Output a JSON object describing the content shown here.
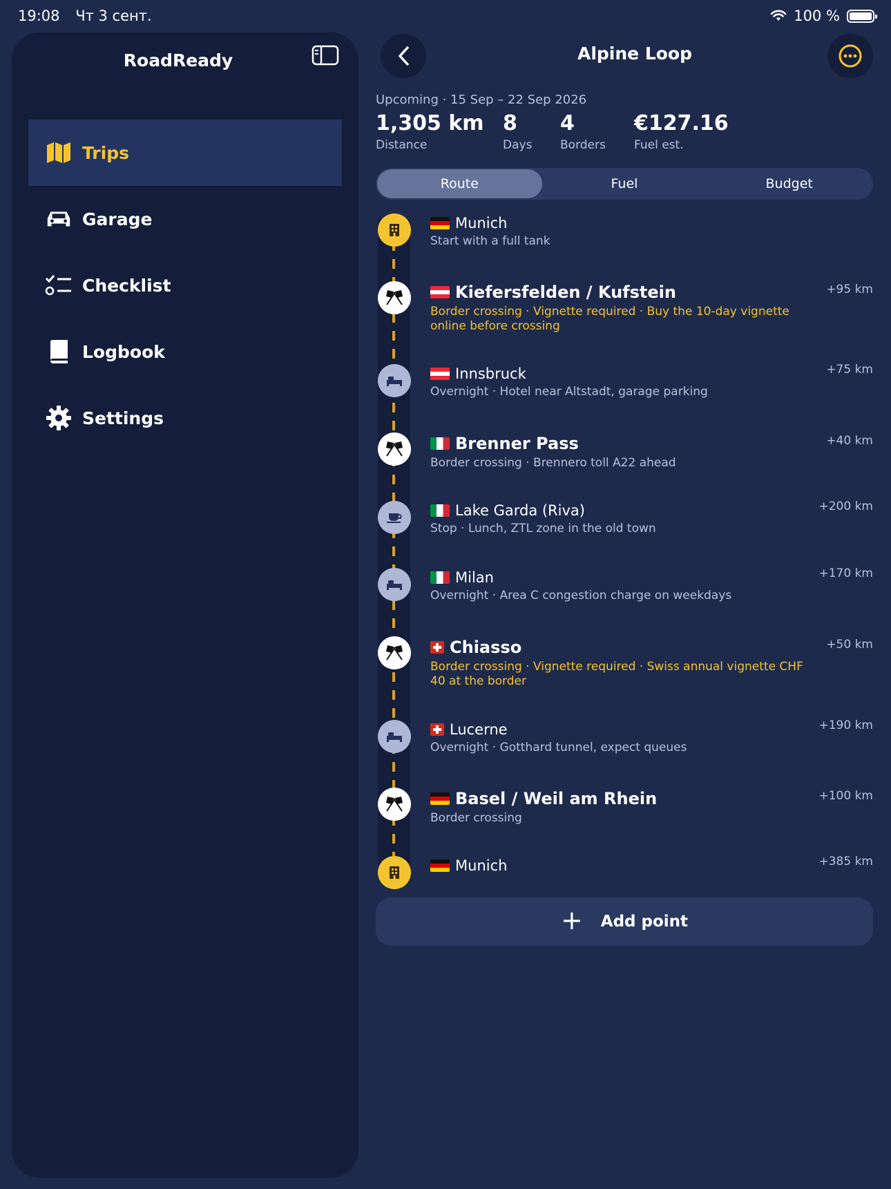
{
  "status_bar": {
    "time": "19:08",
    "date": "Чт 3 сент.",
    "battery": "100 %"
  },
  "sidebar": {
    "title": "RoadReady",
    "items": [
      {
        "label": "Trips",
        "icon": "map-icon",
        "active": true
      },
      {
        "label": "Garage",
        "icon": "car-icon",
        "active": false
      },
      {
        "label": "Checklist",
        "icon": "checklist-icon",
        "active": false
      },
      {
        "label": "Logbook",
        "icon": "book-icon",
        "active": false
      },
      {
        "label": "Settings",
        "icon": "gear-icon",
        "active": false
      }
    ]
  },
  "header": {
    "title": "Alpine Loop"
  },
  "trip": {
    "meta": "Upcoming · 15 Sep – 22 Sep 2026",
    "stats": [
      {
        "value": "1,305 km",
        "label": "Distance"
      },
      {
        "value": "8",
        "label": "Days"
      },
      {
        "value": "4",
        "label": "Borders"
      },
      {
        "value": "€127.16",
        "label": "Fuel est."
      }
    ]
  },
  "tabs": [
    {
      "label": "Route",
      "active": true
    },
    {
      "label": "Fuel",
      "active": false
    },
    {
      "label": "Budget",
      "active": false
    }
  ],
  "route": [
    {
      "name": "Munich",
      "flag": "de",
      "type": "city",
      "sub": "Start with a full tank",
      "dist": ""
    },
    {
      "name": "Kiefersfelden / Kufstein",
      "flag": "at",
      "type": "border",
      "sub": "Border crossing · Vignette required · Buy the 10-day vignette online before crossing",
      "dist": "+95 km",
      "warn": true
    },
    {
      "name": "Innsbruck",
      "flag": "at",
      "type": "overnight",
      "sub": "Overnight · Hotel near Altstadt, garage parking",
      "dist": "+75 km"
    },
    {
      "name": "Brenner Pass",
      "flag": "it",
      "type": "border",
      "sub": "Border crossing · Brennero toll A22 ahead",
      "dist": "+40 km"
    },
    {
      "name": "Lake Garda (Riva)",
      "flag": "it",
      "type": "stop",
      "sub": "Stop · Lunch, ZTL zone in the old town",
      "dist": "+200 km"
    },
    {
      "name": "Milan",
      "flag": "it",
      "type": "overnight",
      "sub": "Overnight · Area C congestion charge on weekdays",
      "dist": "+170 km"
    },
    {
      "name": "Chiasso",
      "flag": "ch",
      "type": "border",
      "sub": "Border crossing · Vignette required · Swiss annual vignette CHF 40 at the border",
      "dist": "+50 km",
      "warn": true
    },
    {
      "name": "Lucerne",
      "flag": "ch",
      "type": "overnight",
      "sub": "Overnight · Gotthard tunnel, expect queues",
      "dist": "+190 km"
    },
    {
      "name": "Basel / Weil am Rhein",
      "flag": "de",
      "type": "border",
      "sub": "Border crossing",
      "dist": "+100 km"
    },
    {
      "name": "Munich",
      "flag": "de",
      "type": "city",
      "sub": "",
      "dist": "+385 km"
    }
  ],
  "add_point": {
    "label": "Add point"
  },
  "colors": {
    "accent": "#f4c430",
    "background": "#1e2a4c",
    "sidebar": "#141e3b"
  }
}
